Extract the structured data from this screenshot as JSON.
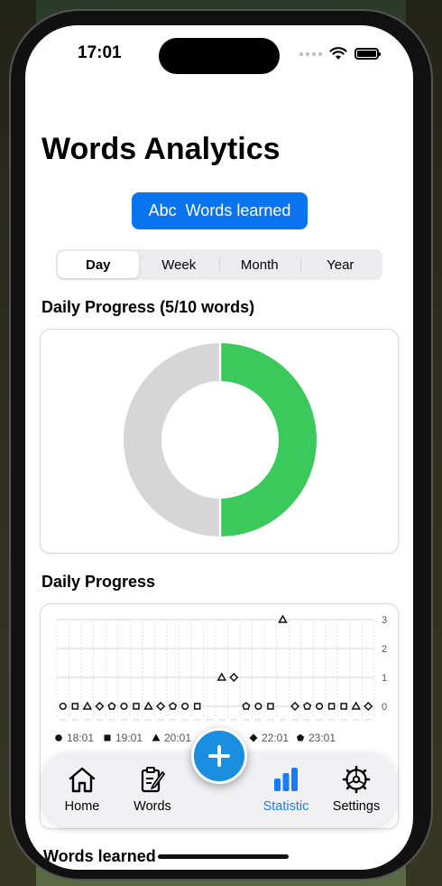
{
  "status": {
    "time": "17:01"
  },
  "page": {
    "title": "Words Analytics"
  },
  "metric_button": {
    "icon_text": "Abc",
    "label": "Words learned"
  },
  "segments": [
    "Day",
    "Week",
    "Month",
    "Year"
  ],
  "selected_segment": "Day",
  "donut": {
    "title": "Daily Progress  (5/10 words)",
    "learned": 5,
    "goal": 10,
    "colors": {
      "learned": "#3cc95c",
      "remaining": "#d6d6d6"
    }
  },
  "scatter": {
    "title": "Daily Progress",
    "chart_data": {
      "type": "scatter",
      "y_ticks": [
        "3",
        "2",
        "1",
        "0"
      ],
      "ylim": [
        0,
        3
      ],
      "legend": [
        "18:01",
        "19:01",
        "20:01",
        "22:01",
        "23:01"
      ],
      "markers_y": [
        0,
        0,
        0,
        0,
        0,
        0,
        0,
        0,
        0,
        0,
        0,
        0,
        0,
        1,
        1,
        0,
        0,
        0,
        3,
        0,
        0,
        0,
        0,
        0,
        0,
        0
      ],
      "marker_shapes": [
        "circle",
        "square",
        "triangle",
        "diamond",
        "pentagon",
        "circle",
        "square",
        "triangle",
        "diamond",
        "pentagon",
        "circle",
        "square",
        "none",
        "triangle",
        "diamond",
        "pentagon",
        "circle",
        "square",
        "triangle",
        "diamond",
        "pentagon",
        "circle",
        "square",
        "square",
        "triangle",
        "diamond"
      ]
    }
  },
  "tabs": [
    {
      "label": "Home",
      "icon": "house-icon"
    },
    {
      "label": "Words",
      "icon": "pencil-note-icon"
    },
    {
      "label": "Statistic",
      "icon": "bar-chart-icon"
    },
    {
      "label": "Settings",
      "icon": "gear-icon"
    }
  ],
  "bottom_section": {
    "title": "Words learned"
  }
}
